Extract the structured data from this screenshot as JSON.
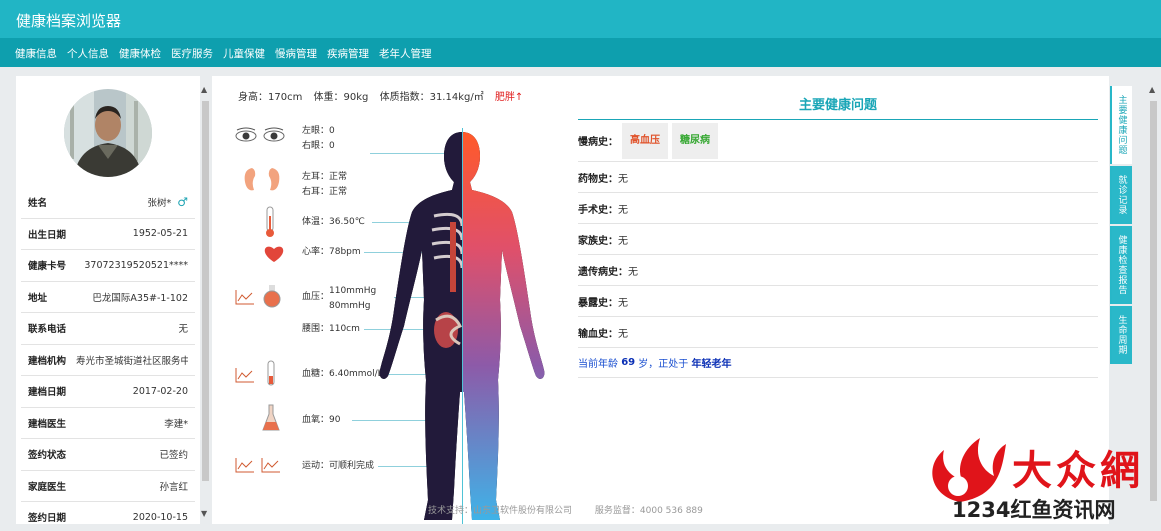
{
  "app": {
    "title": "健康档案浏览器"
  },
  "nav": {
    "items": [
      "健康信息",
      "个人信息",
      "健康体检",
      "医疗服务",
      "儿童保健",
      "慢病管理",
      "疾病管理",
      "老年人管理"
    ]
  },
  "profile": {
    "rows": [
      {
        "label": "姓名",
        "value": "张树*"
      },
      {
        "label": "出生日期",
        "value": "1952-05-21"
      },
      {
        "label": "健康卡号",
        "value": "37072319520521****"
      },
      {
        "label": "地址",
        "value": "巴龙国际A35#-1-102"
      },
      {
        "label": "联系电话",
        "value": "无"
      },
      {
        "label": "建档机构",
        "value": "寿光市圣城街道社区服务中心"
      },
      {
        "label": "建档日期",
        "value": "2017-02-20"
      },
      {
        "label": "建档医生",
        "value": "李建*"
      },
      {
        "label": "签约状态",
        "value": "已签约"
      },
      {
        "label": "家庭医生",
        "value": "孙言红"
      },
      {
        "label": "签约日期",
        "value": "2020-10-15"
      }
    ],
    "gender_icon": "male-icon"
  },
  "vitals": {
    "height": "身高：170cm",
    "weight": "体重：90kg",
    "bmi": "体质指数：31.14kg/㎡",
    "bmi_status": "肥胖↑",
    "left_eye": "左眼：0",
    "right_eye": "右眼：0",
    "left_ear": "左耳：正常",
    "right_ear": "右耳：正常",
    "temperature": "体温：36.50℃",
    "heart_rate": "心率：78bpm",
    "bp_label": "血压：",
    "bp_systolic": "110mmHg",
    "bp_diastolic": "80mmHg",
    "waist": "腰围：110cm",
    "glucose": "血糖：6.40mmol/L",
    "oxygen": "血氧：90",
    "exercise": "运动：可顺利完成"
  },
  "problems": {
    "title": "主要健康问题",
    "chronic_label": "慢病史：",
    "chronic_tags": [
      {
        "text": "高血压",
        "color": "#e0522a"
      },
      {
        "text": "糖尿病",
        "color": "#36a832"
      }
    ],
    "rows": [
      {
        "label": "药物史：",
        "value": "无"
      },
      {
        "label": "手术史：",
        "value": "无"
      },
      {
        "label": "家族史：",
        "value": "无"
      },
      {
        "label": "遗传病史：",
        "value": "无"
      },
      {
        "label": "暴露史：",
        "value": "无"
      },
      {
        "label": "输血史：",
        "value": "无"
      }
    ],
    "age_prefix": "当前年龄",
    "age": "69",
    "age_mid": "岁，正处于",
    "age_stage": "年轻老年"
  },
  "side_tabs": [
    "主要健康问题",
    "就诊记录",
    "健康检查报告",
    "生命周期"
  ],
  "footer": {
    "support": "技术支持：山东卫软件股份有限公司",
    "service": "服务监督：4000 536 889"
  },
  "watermark": {
    "text": "1234红鱼资讯网",
    "big": "大众網"
  },
  "colors": {
    "header": "#21b5c5",
    "nav": "#0e9fae",
    "accent": "#1aa6b7",
    "alert": "#e02020"
  }
}
